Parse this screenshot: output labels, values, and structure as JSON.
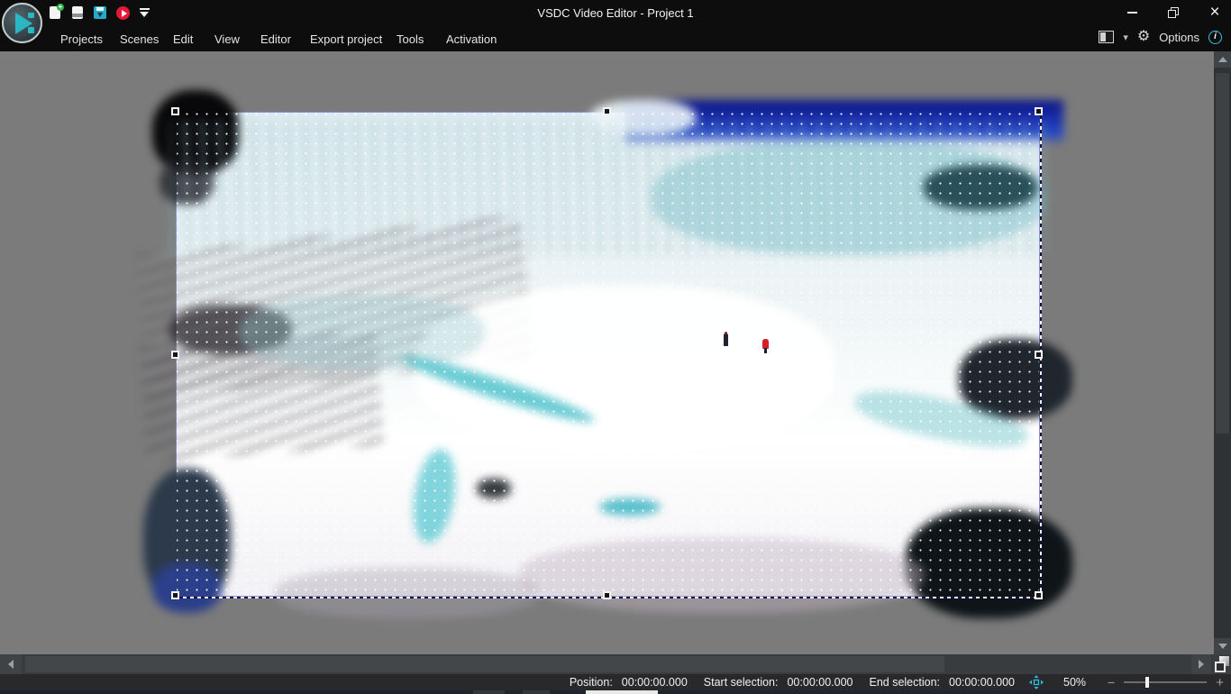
{
  "app": {
    "title": "VSDC Video Editor - Project 1",
    "options_label": "Options"
  },
  "menu": {
    "items": [
      "Projects",
      "Scenes",
      "Edit",
      "View",
      "Editor",
      "Export project",
      "Tools",
      "Activation"
    ]
  },
  "quick_access": {
    "items": [
      "new-project",
      "open-project",
      "save-project",
      "export-video",
      "quick-access-dropdown"
    ]
  },
  "window_controls": {
    "close_glyph": "×"
  },
  "icons": {
    "app_logo": "vsdc-play-circle",
    "gear_glyph": "⚙",
    "layout_chevron_glyph": "▾",
    "info_glyph": "i",
    "fit_scene": "move-arrows-cyan",
    "corner_widget": "overlapping-squares"
  },
  "status_bar": {
    "position_label": "Position:",
    "position_value": "00:00:00.000",
    "start_label": "Start selection:",
    "start_value": "00:00:00.000",
    "end_label": "End selection:",
    "end_value": "00:00:00.000",
    "zoom_percent": "50%",
    "zoom_minus": "−",
    "zoom_plus": "+"
  },
  "scene": {
    "description": "glacier aerial photo with two hikers, selected object with 8 resize handles and dotted grid overlay",
    "zoom_level": "50%"
  },
  "colors": {
    "accent_cyan": "#29b7d8",
    "selection_outline": "#8f8fd8",
    "canvas_gray": "#7b7b7b",
    "sky_blue": "#1a2fb0",
    "export_red": "#e51937",
    "save_teal": "#2aa9c4",
    "new_green": "#2db84b",
    "topbar_bg": "#0d0d0d",
    "statusbar_bg": "#29292b"
  }
}
